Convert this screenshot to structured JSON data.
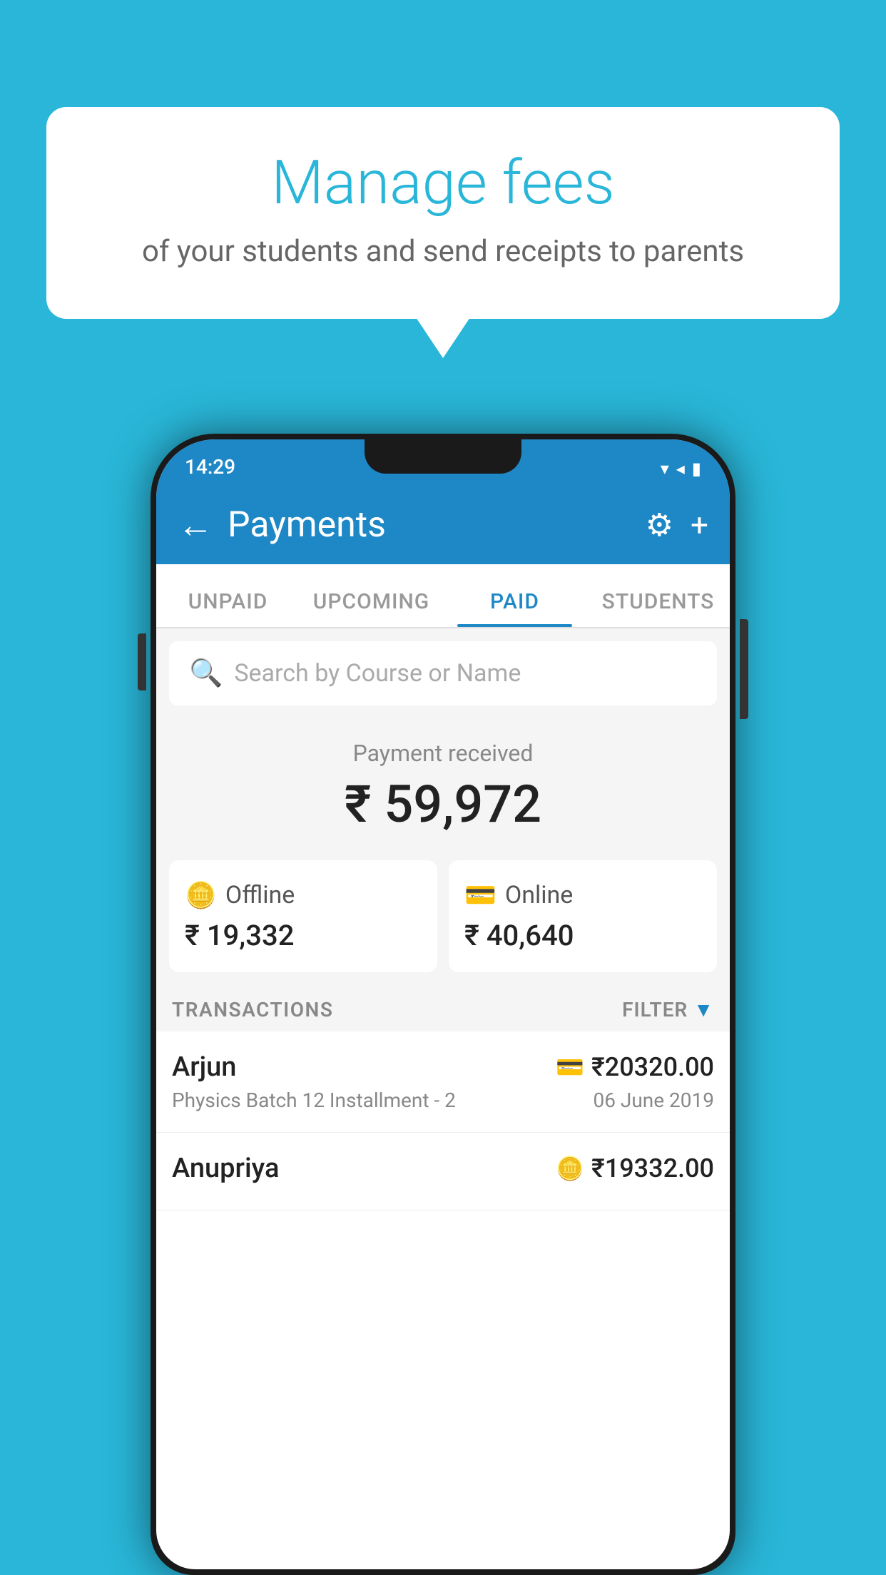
{
  "background_color": "#29B6D8",
  "bubble": {
    "title": "Manage fees",
    "subtitle": "of your students and send receipts to parents"
  },
  "status_bar": {
    "time": "14:29",
    "icons": "▼◀▮"
  },
  "app_bar": {
    "title": "Payments",
    "back_label": "←",
    "settings_label": "⚙",
    "add_label": "+"
  },
  "tabs": [
    {
      "label": "UNPAID",
      "active": false
    },
    {
      "label": "UPCOMING",
      "active": false
    },
    {
      "label": "PAID",
      "active": true
    },
    {
      "label": "STUDENTS",
      "active": false
    }
  ],
  "search": {
    "placeholder": "Search by Course or Name"
  },
  "payment_received": {
    "label": "Payment received",
    "amount": "₹ 59,972"
  },
  "payment_methods": [
    {
      "icon": "🪙",
      "label": "Offline",
      "amount": "₹ 19,332",
      "type": "offline"
    },
    {
      "icon": "💳",
      "label": "Online",
      "amount": "₹ 40,640",
      "type": "online"
    }
  ],
  "transactions": {
    "label": "TRANSACTIONS",
    "filter_label": "FILTER"
  },
  "transaction_rows": [
    {
      "name": "Arjun",
      "amount": "₹20320.00",
      "type_icon": "💳",
      "desc": "Physics Batch 12 Installment - 2",
      "date": "06 June 2019"
    },
    {
      "name": "Anupriya",
      "amount": "₹19332.00",
      "type_icon": "🪙",
      "desc": "",
      "date": ""
    }
  ]
}
